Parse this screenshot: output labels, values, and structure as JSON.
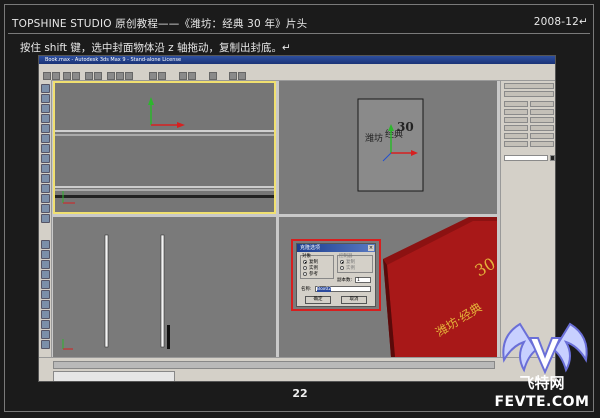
{
  "header": {
    "title": "TOPSHINE STUDIO 原创教程——《潍坊：经典 30 年》片头",
    "date": "2008-12↵"
  },
  "instruction": "按住 shift 键，选中封面物体沿 z 轴拖动，复制出封底。↵",
  "app_window": {
    "title_bar": "Book.max - Autodesk 3ds Max 9 - Stand-alone License"
  },
  "dialog": {
    "title": "克隆选项",
    "close_glyph": "×",
    "object_group": "对象",
    "controller_group": "控制器",
    "options": [
      "复制",
      "实例",
      "参考"
    ],
    "selected_option": "复制",
    "controller_options": [
      "复制",
      "实例"
    ],
    "copies_label": "副本数:",
    "copies_value": "1",
    "name_label": "名称:",
    "name_value": "Box02",
    "ok_label": "确定",
    "cancel_label": "取消"
  },
  "page_number": "22",
  "watermark": {
    "text": "飞特网",
    "sub": "FEVTE.COM"
  },
  "colors": {
    "highlight": "#d81e1e",
    "viewport_active_border": "#f0e070",
    "book_red": "#a11515"
  }
}
